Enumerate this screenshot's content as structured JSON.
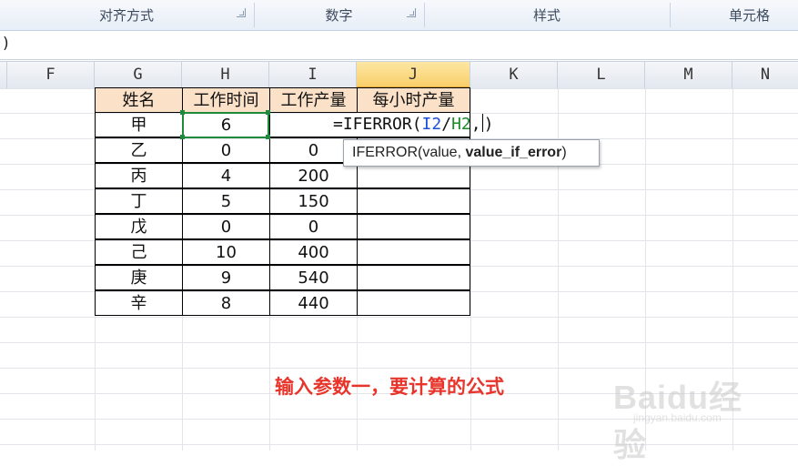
{
  "ribbon": {
    "groups": [
      "对齐方式",
      "数字",
      "样式",
      "单元格"
    ]
  },
  "formula_bar": {
    "text": ")"
  },
  "columns": [
    "F",
    "G",
    "H",
    "I",
    "J",
    "K",
    "L",
    "M",
    "N"
  ],
  "selected_column": "J",
  "table": {
    "headers": [
      "姓名",
      "工作时间",
      "工作产量",
      "每小时产量"
    ],
    "rows": [
      {
        "name": "甲",
        "hours": "6",
        "output": ""
      },
      {
        "name": "乙",
        "hours": "0",
        "output": "0"
      },
      {
        "name": "丙",
        "hours": "4",
        "output": "200"
      },
      {
        "name": "丁",
        "hours": "5",
        "output": "150"
      },
      {
        "name": "戊",
        "hours": "0",
        "output": "0"
      },
      {
        "name": "己",
        "hours": "10",
        "output": "400"
      },
      {
        "name": "庚",
        "hours": "9",
        "output": "540"
      },
      {
        "name": "辛",
        "hours": "8",
        "output": "440"
      }
    ]
  },
  "editing": {
    "prefix": "=IFERROR(",
    "ref1": "I2",
    "slash": "/",
    "ref2": "H2",
    "suffix": ",",
    "close": ")"
  },
  "tooltip": {
    "func": "IFERROR(value, ",
    "current_arg": "value_if_error",
    "close": ")"
  },
  "annotation": "输入参数一，要计算的公式",
  "watermark": {
    "brand": "Baidu经验",
    "url": "jingyan.baidu.com"
  },
  "colors": {
    "accent_green": "#1f8a3b",
    "header_fill": "#fbe1c8",
    "annotation_red": "#e8352b"
  }
}
